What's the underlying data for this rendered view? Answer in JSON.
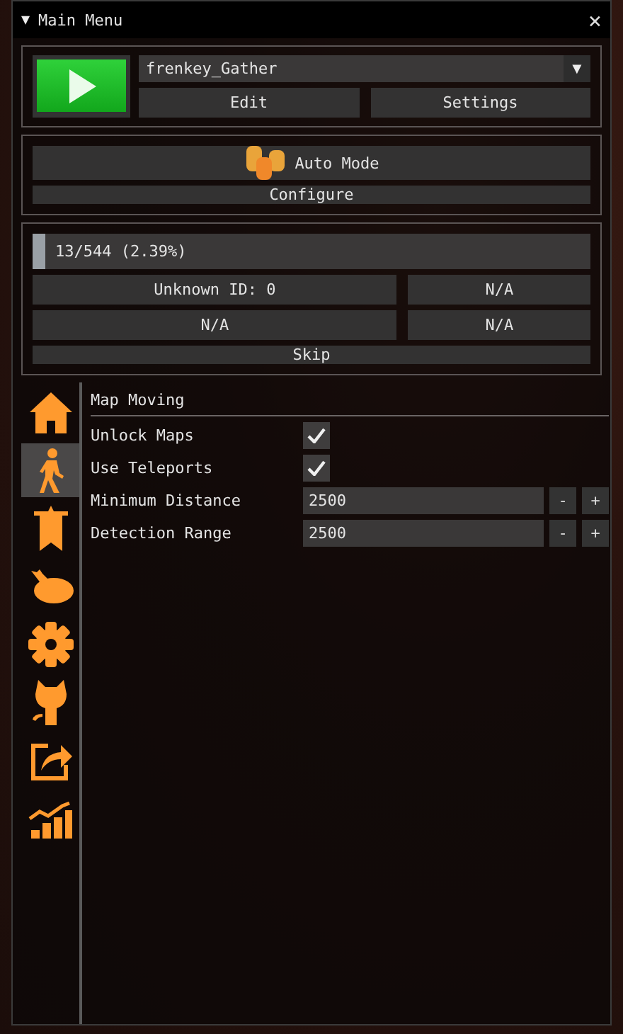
{
  "window": {
    "title": "Main Menu",
    "collapse_glyph": "▼",
    "close_glyph": "×"
  },
  "profile": {
    "value": "frenkey_Gather",
    "dropdown_glyph": "▼",
    "buttons": [
      "Edit",
      "Settings"
    ]
  },
  "auto": {
    "label": "Auto Mode",
    "configure": "Configure"
  },
  "progress": {
    "text": "13/544 (2.39%)",
    "level": 0.0239,
    "cells": [
      "Unknown ID: 0",
      "N/A",
      "N/A",
      "N/A"
    ],
    "skip": "Skip"
  },
  "sidebar": {
    "items": [
      {
        "selected": false
      },
      {
        "selected": true
      },
      {
        "selected": false
      },
      {
        "selected": false
      },
      {
        "selected": false
      },
      {
        "selected": false
      },
      {
        "selected": false
      },
      {
        "selected": false
      }
    ]
  },
  "section": {
    "title": "Map Moving",
    "rows": [
      {
        "kind": "checkbox",
        "label": "Unlock Maps",
        "checked": true
      },
      {
        "kind": "checkbox",
        "label": "Use Teleports",
        "checked": true
      },
      {
        "kind": "number",
        "label": "Minimum Distance",
        "value": "2500",
        "minus": "-",
        "plus": "+"
      },
      {
        "kind": "number",
        "label": "Detection Range",
        "value": "2500",
        "minus": "-",
        "plus": "+"
      }
    ]
  }
}
